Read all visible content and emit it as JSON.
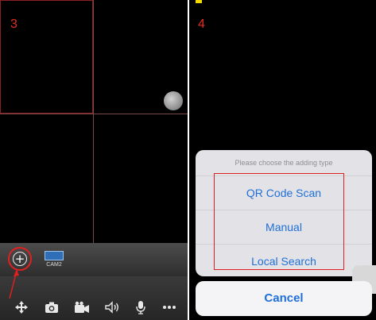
{
  "steps": {
    "left": "3",
    "right": "4"
  },
  "device_bar": {
    "add_icon": "plus-circle-icon",
    "camera_label": "CAM2"
  },
  "toolbar": {
    "icons": [
      "move-arrows-icon",
      "camera-snapshot-icon",
      "video-record-icon",
      "speaker-icon",
      "microphone-icon",
      "more-dots-icon"
    ]
  },
  "action_sheet": {
    "title": "Please choose the adding type",
    "options": [
      "QR Code Scan",
      "Manual",
      "Local Search"
    ],
    "cancel_label": "Cancel"
  },
  "colors": {
    "highlight": "#e02020",
    "ios_blue": "#1f6fd8",
    "step_number": "#e03020"
  }
}
